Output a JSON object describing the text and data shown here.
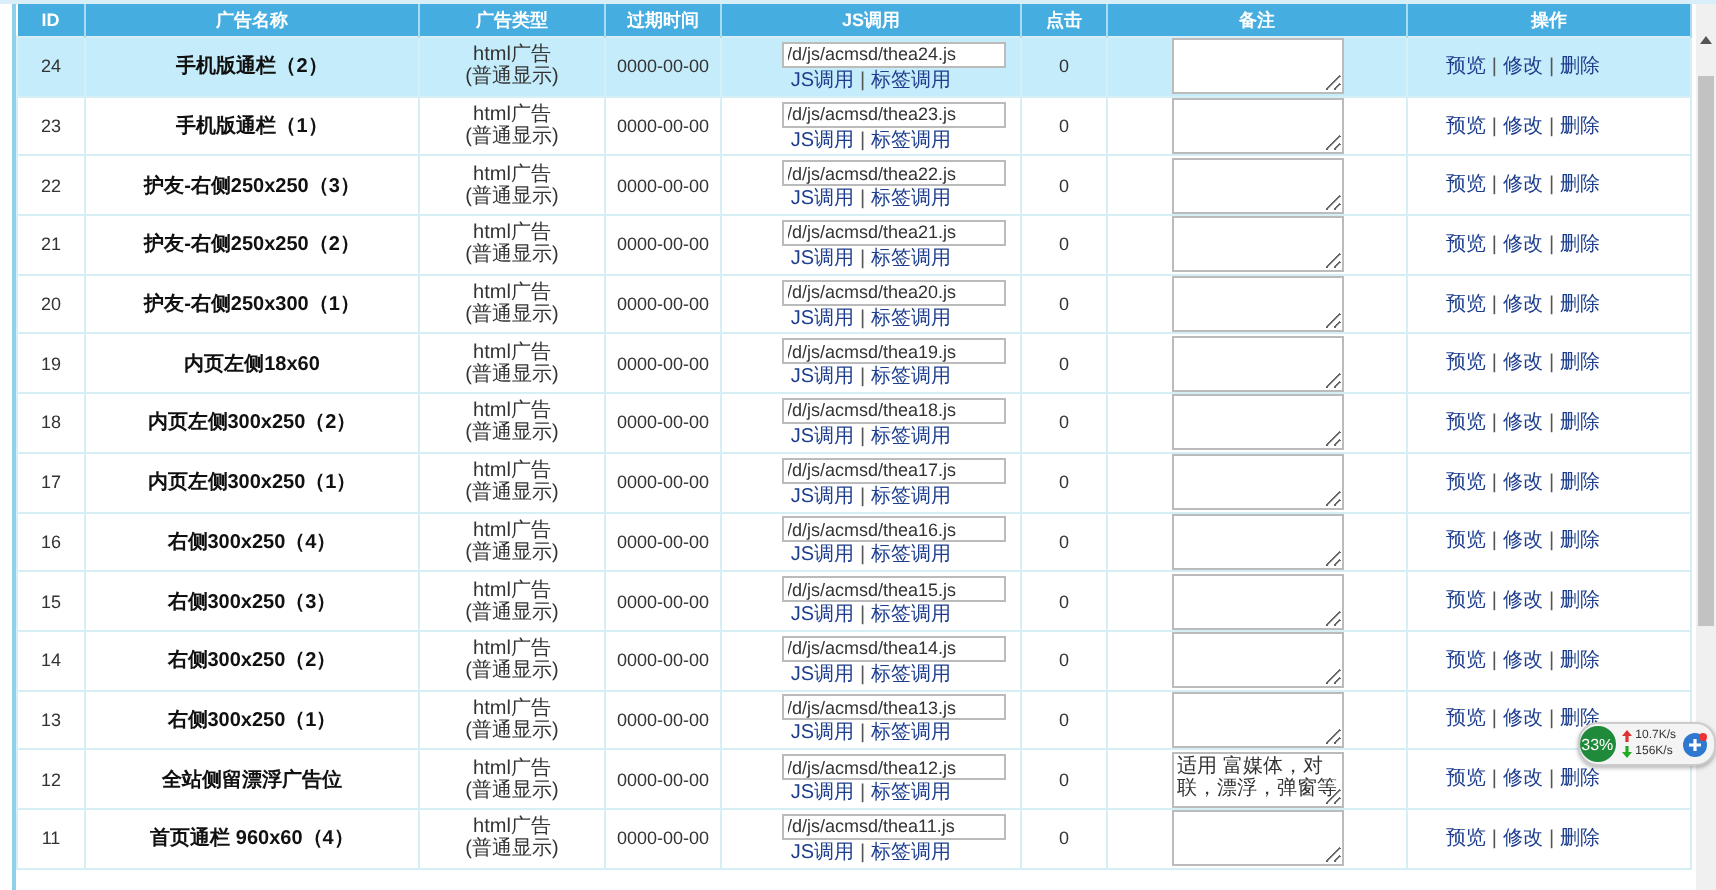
{
  "table": {
    "columns": [
      "ID",
      "广告名称",
      "广告类型",
      "过期时间",
      "JS调用",
      "点击",
      "备注",
      "操作"
    ],
    "rows": [
      {
        "id": "24",
        "name": "手机版通栏（2）",
        "type": [
          "html广告",
          "(普通显示)"
        ],
        "expires": "0000-00-00",
        "js_path": "/d/js/acmsd/thea24.js",
        "js_links": [
          "JS调用",
          "|",
          "标签调用"
        ],
        "clicks": "0",
        "actions": [
          "预览",
          "|",
          "修改",
          "|",
          "删除"
        ],
        "selected": true
      },
      {
        "id": "23",
        "name": "手机版通栏（1）",
        "type": [
          "html广告",
          "(普通显示)"
        ],
        "expires": "0000-00-00",
        "js_path": "/d/js/acmsd/thea23.js",
        "js_links": [
          "JS调用",
          "|",
          "标签调用"
        ],
        "clicks": "0",
        "actions": [
          "预览",
          "|",
          "修改",
          "|",
          "删除"
        ],
        "selected": false
      },
      {
        "id": "22",
        "name": "护友-右侧250x250（3）",
        "type": [
          "html广告",
          "(普通显示)"
        ],
        "expires": "0000-00-00",
        "js_path": "/d/js/acmsd/thea22.js",
        "js_links": [
          "JS调用",
          "|",
          "标签调用"
        ],
        "clicks": "0",
        "actions": [
          "预览",
          "|",
          "修改",
          "|",
          "删除"
        ],
        "selected": false
      },
      {
        "id": "21",
        "name": "护友-右侧250x250（2）",
        "type": [
          "html广告",
          "(普通显示)"
        ],
        "expires": "0000-00-00",
        "js_path": "/d/js/acmsd/thea21.js",
        "js_links": [
          "JS调用",
          "|",
          "标签调用"
        ],
        "clicks": "0",
        "actions": [
          "预览",
          "|",
          "修改",
          "|",
          "删除"
        ],
        "selected": false
      },
      {
        "id": "20",
        "name": "护友-右侧250x300（1）",
        "type": [
          "html广告",
          "(普通显示)"
        ],
        "expires": "0000-00-00",
        "js_path": "/d/js/acmsd/thea20.js",
        "js_links": [
          "JS调用",
          "|",
          "标签调用"
        ],
        "clicks": "0",
        "actions": [
          "预览",
          "|",
          "修改",
          "|",
          "删除"
        ],
        "selected": false
      },
      {
        "id": "19",
        "name": "内页左侧18x60",
        "type": [
          "html广告",
          "(普通显示)"
        ],
        "expires": "0000-00-00",
        "js_path": "/d/js/acmsd/thea19.js",
        "js_links": [
          "JS调用",
          "|",
          "标签调用"
        ],
        "clicks": "0",
        "actions": [
          "预览",
          "|",
          "修改",
          "|",
          "删除"
        ],
        "selected": false
      },
      {
        "id": "18",
        "name": "内页左侧300x250（2）",
        "type": [
          "html广告",
          "(普通显示)"
        ],
        "expires": "0000-00-00",
        "js_path": "/d/js/acmsd/thea18.js",
        "js_links": [
          "JS调用",
          "|",
          "标签调用"
        ],
        "clicks": "0",
        "actions": [
          "预览",
          "|",
          "修改",
          "|",
          "删除"
        ],
        "selected": false
      },
      {
        "id": "17",
        "name": "内页左侧300x250（1）",
        "type": [
          "html广告",
          "(普通显示)"
        ],
        "expires": "0000-00-00",
        "js_path": "/d/js/acmsd/thea17.js",
        "js_links": [
          "JS调用",
          "|",
          "标签调用"
        ],
        "clicks": "0",
        "actions": [
          "预览",
          "|",
          "修改",
          "|",
          "删除"
        ],
        "selected": false
      },
      {
        "id": "16",
        "name": "右侧300x250（4）",
        "type": [
          "html广告",
          "(普通显示)"
        ],
        "expires": "0000-00-00",
        "js_path": "/d/js/acmsd/thea16.js",
        "js_links": [
          "JS调用",
          "|",
          "标签调用"
        ],
        "clicks": "0",
        "actions": [
          "预览",
          "|",
          "修改",
          "|",
          "删除"
        ],
        "selected": false
      },
      {
        "id": "15",
        "name": "右侧300x250（3）",
        "type": [
          "html广告",
          "(普通显示)"
        ],
        "expires": "0000-00-00",
        "js_path": "/d/js/acmsd/thea15.js",
        "js_links": [
          "JS调用",
          "|",
          "标签调用"
        ],
        "clicks": "0",
        "actions": [
          "预览",
          "|",
          "修改",
          "|",
          "删除"
        ],
        "selected": false
      },
      {
        "id": "14",
        "name": "右侧300x250（2）",
        "type": [
          "html广告",
          "(普通显示)"
        ],
        "expires": "0000-00-00",
        "js_path": "/d/js/acmsd/thea14.js",
        "js_links": [
          "JS调用",
          "|",
          "标签调用"
        ],
        "clicks": "0",
        "actions": [
          "预览",
          "|",
          "修改",
          "|",
          "删除"
        ],
        "selected": false
      },
      {
        "id": "13",
        "name": "右侧300x250（1）",
        "type": [
          "html广告",
          "(普通显示)"
        ],
        "expires": "0000-00-00",
        "js_path": "/d/js/acmsd/thea13.js",
        "js_links": [
          "JS调用",
          "|",
          "标签调用"
        ],
        "clicks": "0",
        "actions": [
          "预览",
          "|",
          "修改",
          "|",
          "删除"
        ],
        "selected": false
      },
      {
        "id": "12",
        "name": "全站侧留漂浮广告位",
        "type": [
          "html广告",
          "(普通显示)"
        ],
        "expires": "0000-00-00",
        "js_path": "/d/js/acmsd/thea12.js",
        "js_links": [
          "JS调用",
          "|",
          "标签调用"
        ],
        "clicks": "0",
        "note": "适用 富媒体，对联，漂浮，弹窗等",
        "actions": [
          "预览",
          "|",
          "修改",
          "|",
          "删除"
        ],
        "selected": false
      },
      {
        "id": "11",
        "name": "首页通栏 960x60（4）",
        "type": [
          "html广告",
          "(普通显示)"
        ],
        "expires": "0000-00-00",
        "js_path": "/d/js/acmsd/thea11.js",
        "js_links": [
          "JS调用",
          "|",
          "标签调用"
        ],
        "clicks": "0",
        "actions": [
          "预览",
          "|",
          "修改",
          "|",
          "删除"
        ],
        "selected": false
      }
    ]
  },
  "network_widget": {
    "percent": "33%",
    "upload": "10.7K/s",
    "download": "156K/s"
  }
}
